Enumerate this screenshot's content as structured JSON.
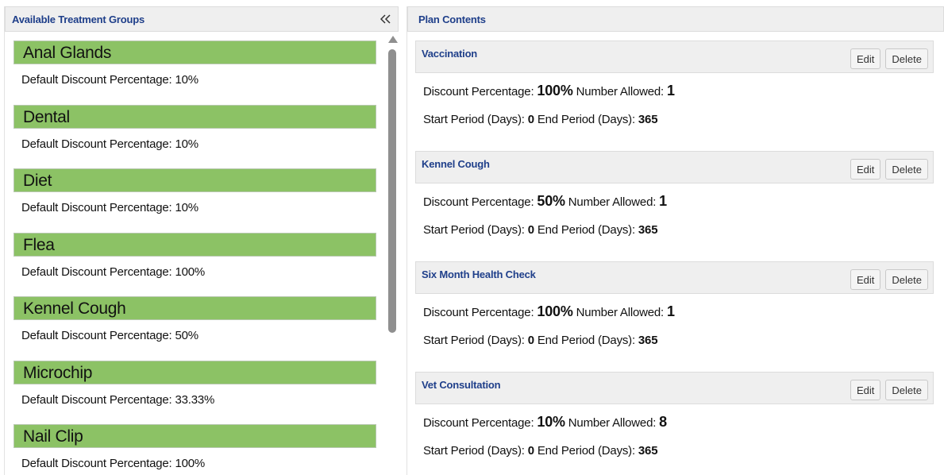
{
  "left": {
    "title": "Available Treatment Groups",
    "groups": [
      {
        "name": "Anal Glands",
        "detail": "Default Discount Percentage: 10%"
      },
      {
        "name": "Dental",
        "detail": "Default Discount Percentage: 10%"
      },
      {
        "name": "Diet",
        "detail": "Default Discount Percentage: 10%"
      },
      {
        "name": "Flea",
        "detail": "Default Discount Percentage: 100%"
      },
      {
        "name": "Kennel Cough",
        "detail": "Default Discount Percentage: 50%"
      },
      {
        "name": "Microchip",
        "detail": "Default Discount Percentage: 33.33%"
      },
      {
        "name": "Nail Clip",
        "detail": "Default Discount Percentage: 100%"
      }
    ]
  },
  "right": {
    "title": "Plan Contents",
    "labels": {
      "discount": "Discount Percentage:",
      "allowed": "Number Allowed:",
      "start": "Start Period (Days):",
      "end": "End Period (Days):",
      "edit": "Edit",
      "delete": "Delete"
    },
    "items": [
      {
        "name": "Vaccination",
        "discount": "100%",
        "allowed": "1",
        "start": "0",
        "end": "365"
      },
      {
        "name": "Kennel Cough",
        "discount": "50%",
        "allowed": "1",
        "start": "0",
        "end": "365"
      },
      {
        "name": "Six Month Health Check",
        "discount": "100%",
        "allowed": "1",
        "start": "0",
        "end": "365"
      },
      {
        "name": "Vet Consultation",
        "discount": "10%",
        "allowed": "8",
        "start": "0",
        "end": "365"
      }
    ]
  },
  "colors": {
    "group_bar": "#8cc265",
    "header_text": "#1f3f8a"
  },
  "icons": {
    "collapse": "double-chevron-left-icon"
  }
}
